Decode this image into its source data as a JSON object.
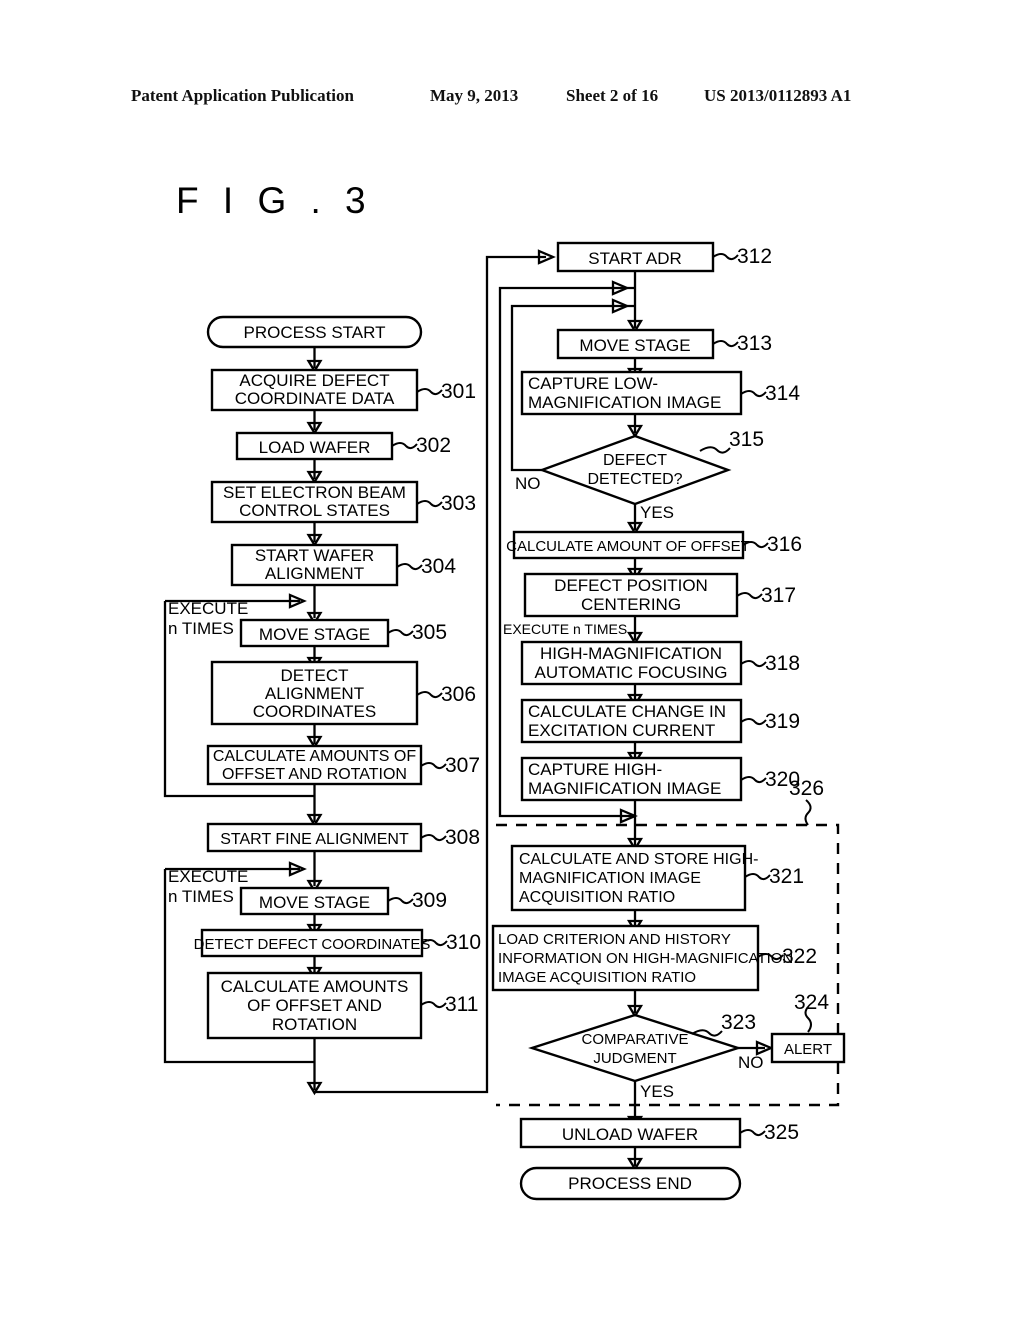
{
  "header": {
    "publication": "Patent Application Publication",
    "date": "May 9, 2013",
    "sheet": "Sheet 2 of 16",
    "number": "US 2013/0112893 A1"
  },
  "figure": {
    "title": "F I G . 3"
  },
  "flowchart": {
    "type": "flowchart",
    "left_column": {
      "start_terminal": "PROCESS START",
      "steps": [
        {
          "ref": "301",
          "lines": [
            "ACQUIRE DEFECT",
            "COORDINATE DATA"
          ]
        },
        {
          "ref": "302",
          "lines": [
            "LOAD WAFER"
          ]
        },
        {
          "ref": "303",
          "lines": [
            "SET ELECTRON BEAM",
            "CONTROL STATES"
          ]
        },
        {
          "ref": "304",
          "lines": [
            "START WAFER",
            "ALIGNMENT"
          ]
        },
        {
          "ref": "305",
          "lines": [
            "MOVE STAGE"
          ]
        },
        {
          "ref": "306",
          "lines": [
            "DETECT",
            "ALIGNMENT",
            "COORDINATES"
          ]
        },
        {
          "ref": "307",
          "lines": [
            "CALCULATE AMOUNTS OF",
            "OFFSET AND ROTATION"
          ]
        },
        {
          "ref": "308",
          "lines": [
            "START FINE ALIGNMENT"
          ]
        },
        {
          "ref": "309",
          "lines": [
            "MOVE STAGE"
          ]
        },
        {
          "ref": "310",
          "lines": [
            "DETECT DEFECT COORDINATES"
          ]
        },
        {
          "ref": "311",
          "lines": [
            "CALCULATE AMOUNTS",
            "OF OFFSET AND",
            "ROTATION"
          ]
        }
      ],
      "loop_labels": [
        {
          "lines": [
            "EXECUTE",
            "n TIMES"
          ]
        },
        {
          "lines": [
            "EXECUTE",
            "n TIMES"
          ]
        }
      ]
    },
    "right_column": {
      "steps": [
        {
          "ref": "312",
          "lines": [
            "START ADR"
          ]
        },
        {
          "ref": "313",
          "lines": [
            "MOVE STAGE"
          ]
        },
        {
          "ref": "314",
          "lines": [
            "CAPTURE LOW-",
            "MAGNIFICATION IMAGE"
          ]
        },
        {
          "ref": "315",
          "lines": [
            "DEFECT",
            "DETECTED?"
          ],
          "shape": "decision"
        },
        {
          "ref": "316",
          "lines": [
            "CALCULATE AMOUNT OF OFFSET"
          ]
        },
        {
          "ref": "317",
          "lines": [
            "DEFECT POSITION",
            "CENTERING"
          ]
        },
        {
          "ref": "318",
          "lines": [
            "HIGH-MAGNIFICATION",
            "AUTOMATIC FOCUSING"
          ]
        },
        {
          "ref": "319",
          "lines": [
            "CALCULATE CHANGE IN",
            "EXCITATION CURRENT"
          ]
        },
        {
          "ref": "320",
          "lines": [
            "CAPTURE HIGH-",
            "MAGNIFICATION IMAGE"
          ]
        },
        {
          "ref": "321",
          "lines": [
            "CALCULATE AND STORE HIGH-",
            "MAGNIFICATION IMAGE",
            "ACQUISITION RATIO"
          ]
        },
        {
          "ref": "322",
          "lines": [
            "LOAD CRITERION AND HISTORY",
            "INFORMATION ON HIGH-MAGNIFICATION",
            "IMAGE ACQUISITION RATIO"
          ]
        },
        {
          "ref": "323",
          "lines": [
            "COMPARATIVE",
            "JUDGMENT"
          ],
          "shape": "decision"
        },
        {
          "ref": "324",
          "lines": [
            "ALERT"
          ]
        },
        {
          "ref": "325",
          "lines": [
            "UNLOAD WAFER"
          ]
        }
      ],
      "end_terminal": "PROCESS END",
      "group_ref": "326",
      "loop_label": "EXECUTE n TIMES",
      "branch_labels": {
        "defect_no": "NO",
        "defect_yes": "YES",
        "judgment_no": "NO",
        "judgment_yes": "YES"
      }
    }
  }
}
